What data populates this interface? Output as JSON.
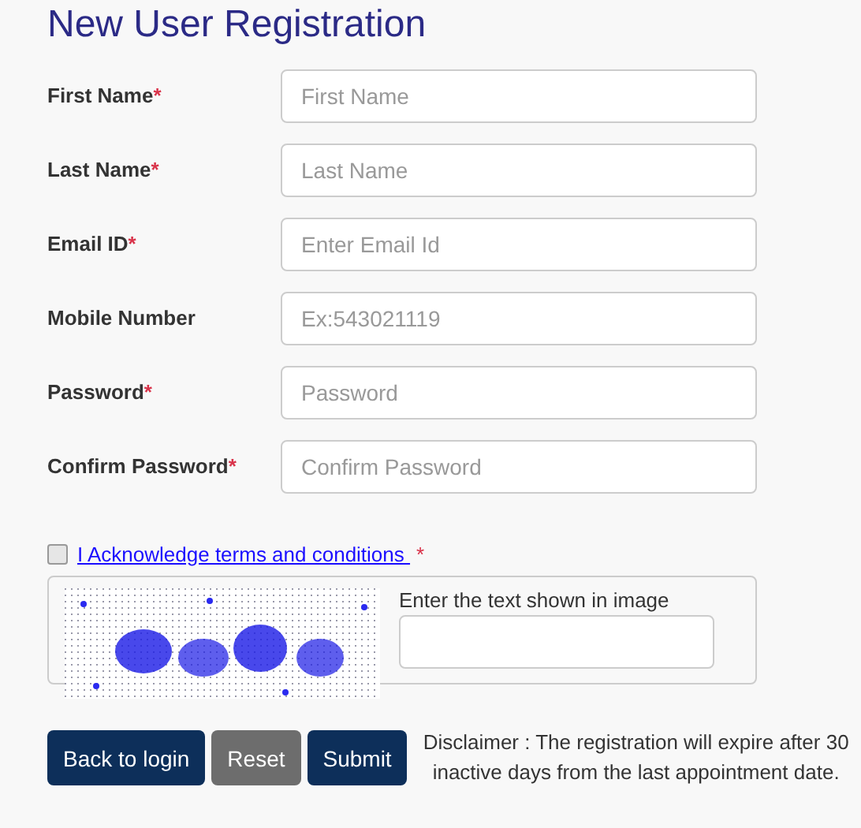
{
  "title": "New User Registration",
  "fields": [
    {
      "label": "First Name",
      "mark": "*",
      "placeholder": "First Name"
    },
    {
      "label": "Last Name",
      "mark": "*",
      "placeholder": "Last Name"
    },
    {
      "label": "Email ID",
      "mark": "*",
      "placeholder": "Enter Email Id"
    },
    {
      "label": "Mobile Number",
      "placeholder": "Ex:543021119"
    },
    {
      "label": "Password",
      "mark": "*",
      "placeholder": "Password"
    },
    {
      "label": "Confirm Password",
      "mark": "*",
      "placeholder": "Confirm Password"
    }
  ],
  "terms": {
    "checked": false,
    "label": "I Acknowledge terms and conditions ",
    "mark": "*"
  },
  "captcha": {
    "prompt": "Enter the text shown in image"
  },
  "buttons": [
    {
      "label": "Back to login",
      "kind": "primary"
    },
    {
      "label": "Reset",
      "kind": "secondary"
    },
    {
      "label": "Submit",
      "kind": "primary"
    }
  ],
  "disclaimer": "Disclaimer : The registration will expire after 30 inactive days from the last appointment date."
}
